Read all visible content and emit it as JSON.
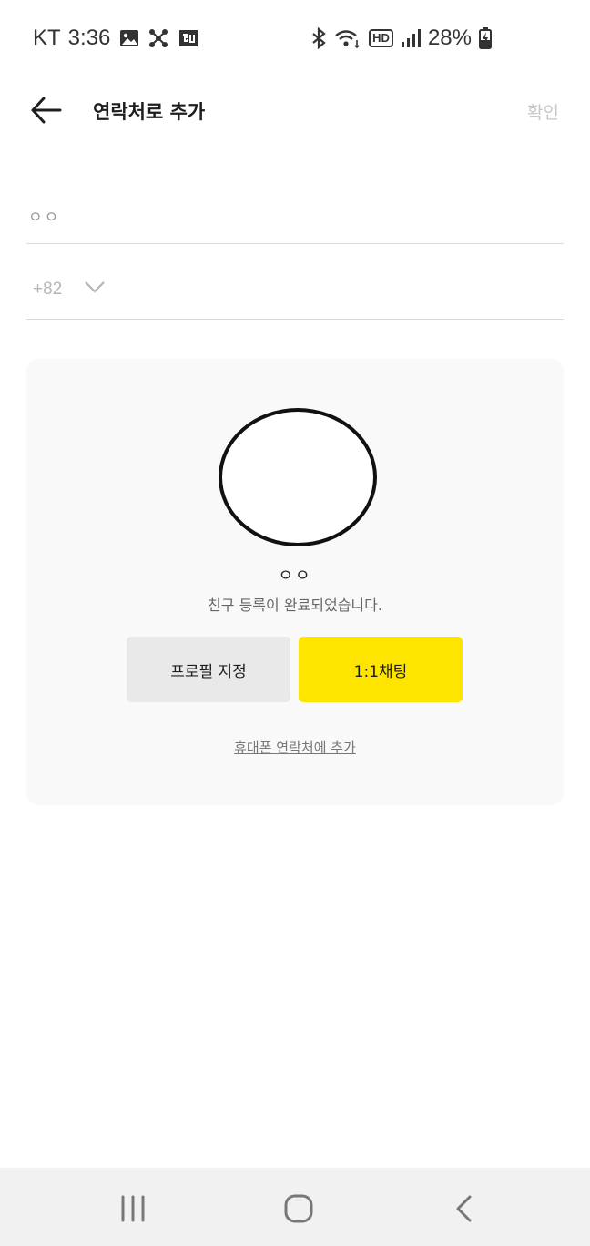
{
  "status_bar": {
    "carrier": "KT",
    "time": "3:36",
    "network_label": "HD",
    "battery": "28%"
  },
  "header": {
    "title": "연락처로 추가",
    "confirm_label": "확인"
  },
  "form": {
    "name_value": "ㅇㅇ",
    "country_code": "+82"
  },
  "card": {
    "friend_name": "ㅇㅇ",
    "message": "친구 등록이 완료되었습니다.",
    "profile_button": "프로필 지정",
    "chat_button": "1:1채팅",
    "add_contact_link": "휴대폰 연락처에 추가"
  },
  "colors": {
    "accent": "#fee500",
    "card_bg": "#f9f9f9",
    "secondary_button": "#e9e9e9"
  },
  "icons": {
    "status_left": [
      "image-icon",
      "network-icon",
      "app-icon"
    ],
    "status_right": [
      "bluetooth-icon",
      "wifi-icon",
      "hd-icon",
      "signal-icon",
      "battery-icon"
    ],
    "header": [
      "back-arrow-icon"
    ],
    "navigation": [
      "recent-apps-icon",
      "home-icon",
      "back-icon"
    ]
  }
}
